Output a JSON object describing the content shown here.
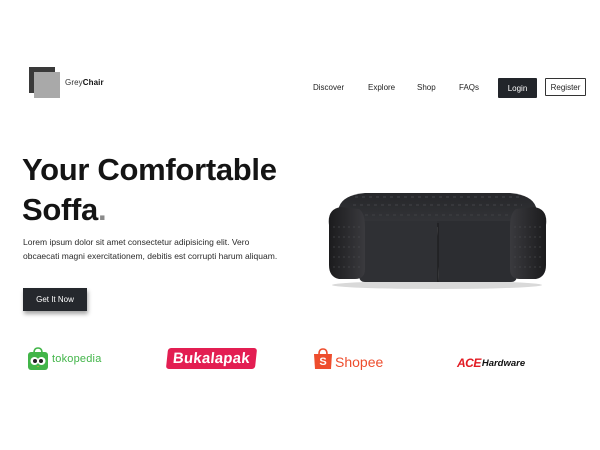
{
  "brand": {
    "name_light": "Grey",
    "name_bold": "Chair"
  },
  "nav": {
    "links": [
      "Discover",
      "Explore",
      "Shop",
      "FAQs"
    ],
    "login_label": "Login",
    "register_label": "Register"
  },
  "hero": {
    "title_line1": "Your Comfortable",
    "title_line2": "Soffa",
    "title_dot": ".",
    "description": "Lorem ipsum dolor sit amet consectetur adipisicing elit. Vero obcaecati magni exercitationem, debitis est corrupti harum aliquam.",
    "cta_label": "Get It Now"
  },
  "partners": {
    "tokopedia": "tokopedia",
    "bukalapak": "Bukalapak",
    "shopee": "Shopee",
    "ace": "ACE",
    "ace_suffix": "Hardware"
  },
  "colors": {
    "dark": "#22252a",
    "tokopedia_green": "#42b549",
    "bukalapak_red": "#e31e52",
    "shopee_orange": "#ee4d2d",
    "ace_red": "#e21b23"
  }
}
